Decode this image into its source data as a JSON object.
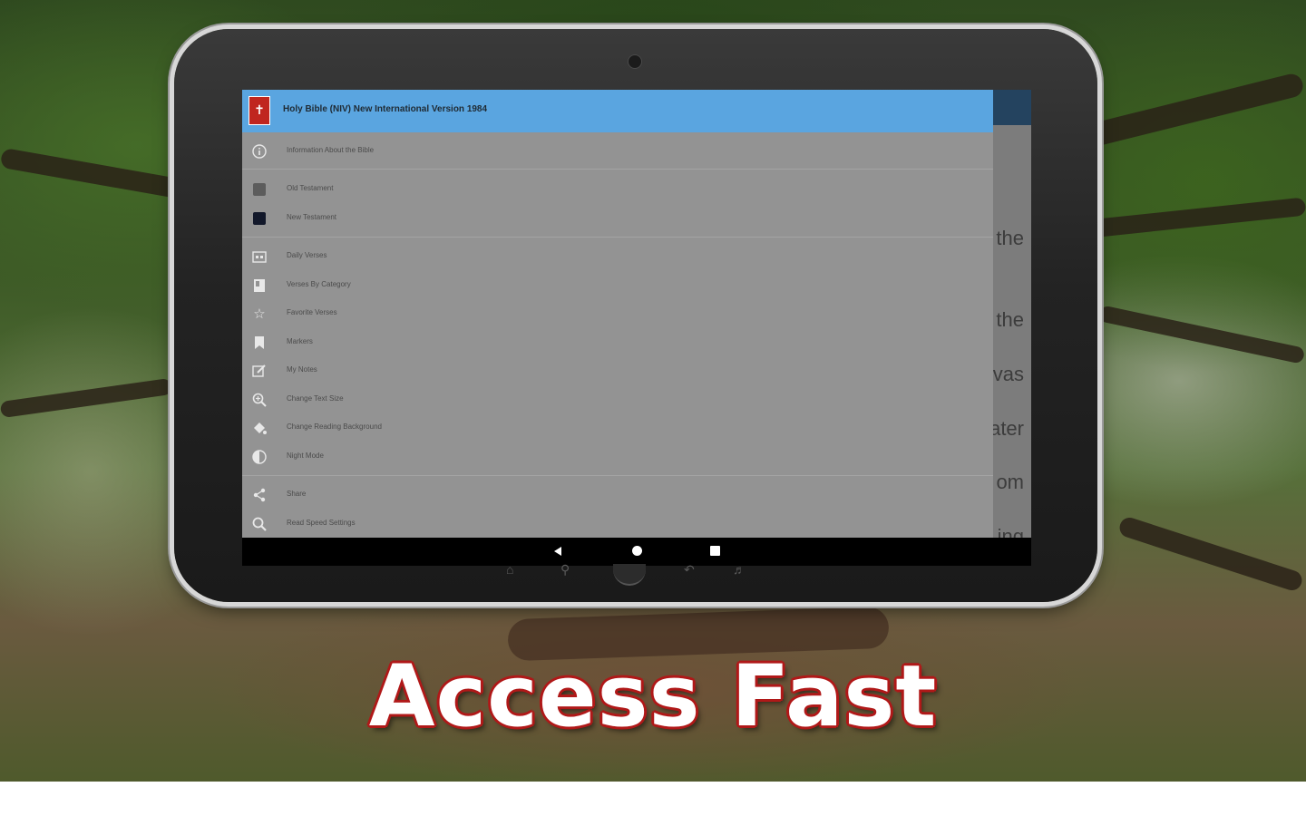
{
  "drawer": {
    "title": "Holy Bible (NIV) New International Version 1984",
    "items": [
      {
        "label": "Information About the Bible",
        "icon": "info-icon"
      },
      {
        "label": "Old Testament",
        "icon": "book-gray-icon"
      },
      {
        "label": "New Testament",
        "icon": "book-dark-icon"
      },
      {
        "label": "Daily Verses",
        "icon": "calendar-icon"
      },
      {
        "label": "Verses By Category",
        "icon": "category-icon"
      },
      {
        "label": "Favorite Verses",
        "icon": "star-icon"
      },
      {
        "label": "Markers",
        "icon": "bookmark-icon"
      },
      {
        "label": "My Notes",
        "icon": "edit-icon"
      },
      {
        "label": "Change Text Size",
        "icon": "zoom-icon"
      },
      {
        "label": "Change Reading Background",
        "icon": "paint-icon"
      },
      {
        "label": "Night Mode",
        "icon": "night-icon"
      },
      {
        "label": "Share",
        "icon": "share-icon"
      },
      {
        "label": "Read Speed Settings",
        "icon": "search-icon"
      }
    ]
  },
  "reader_fragments": [
    "the",
    "the",
    "vas",
    "ater",
    "om",
    "ing"
  ],
  "headline": "Access Fast",
  "colors": {
    "header": "#5aa5e0",
    "app_bar": "#24435f",
    "drawer": "#939393",
    "headline_outline": "#b01818"
  }
}
